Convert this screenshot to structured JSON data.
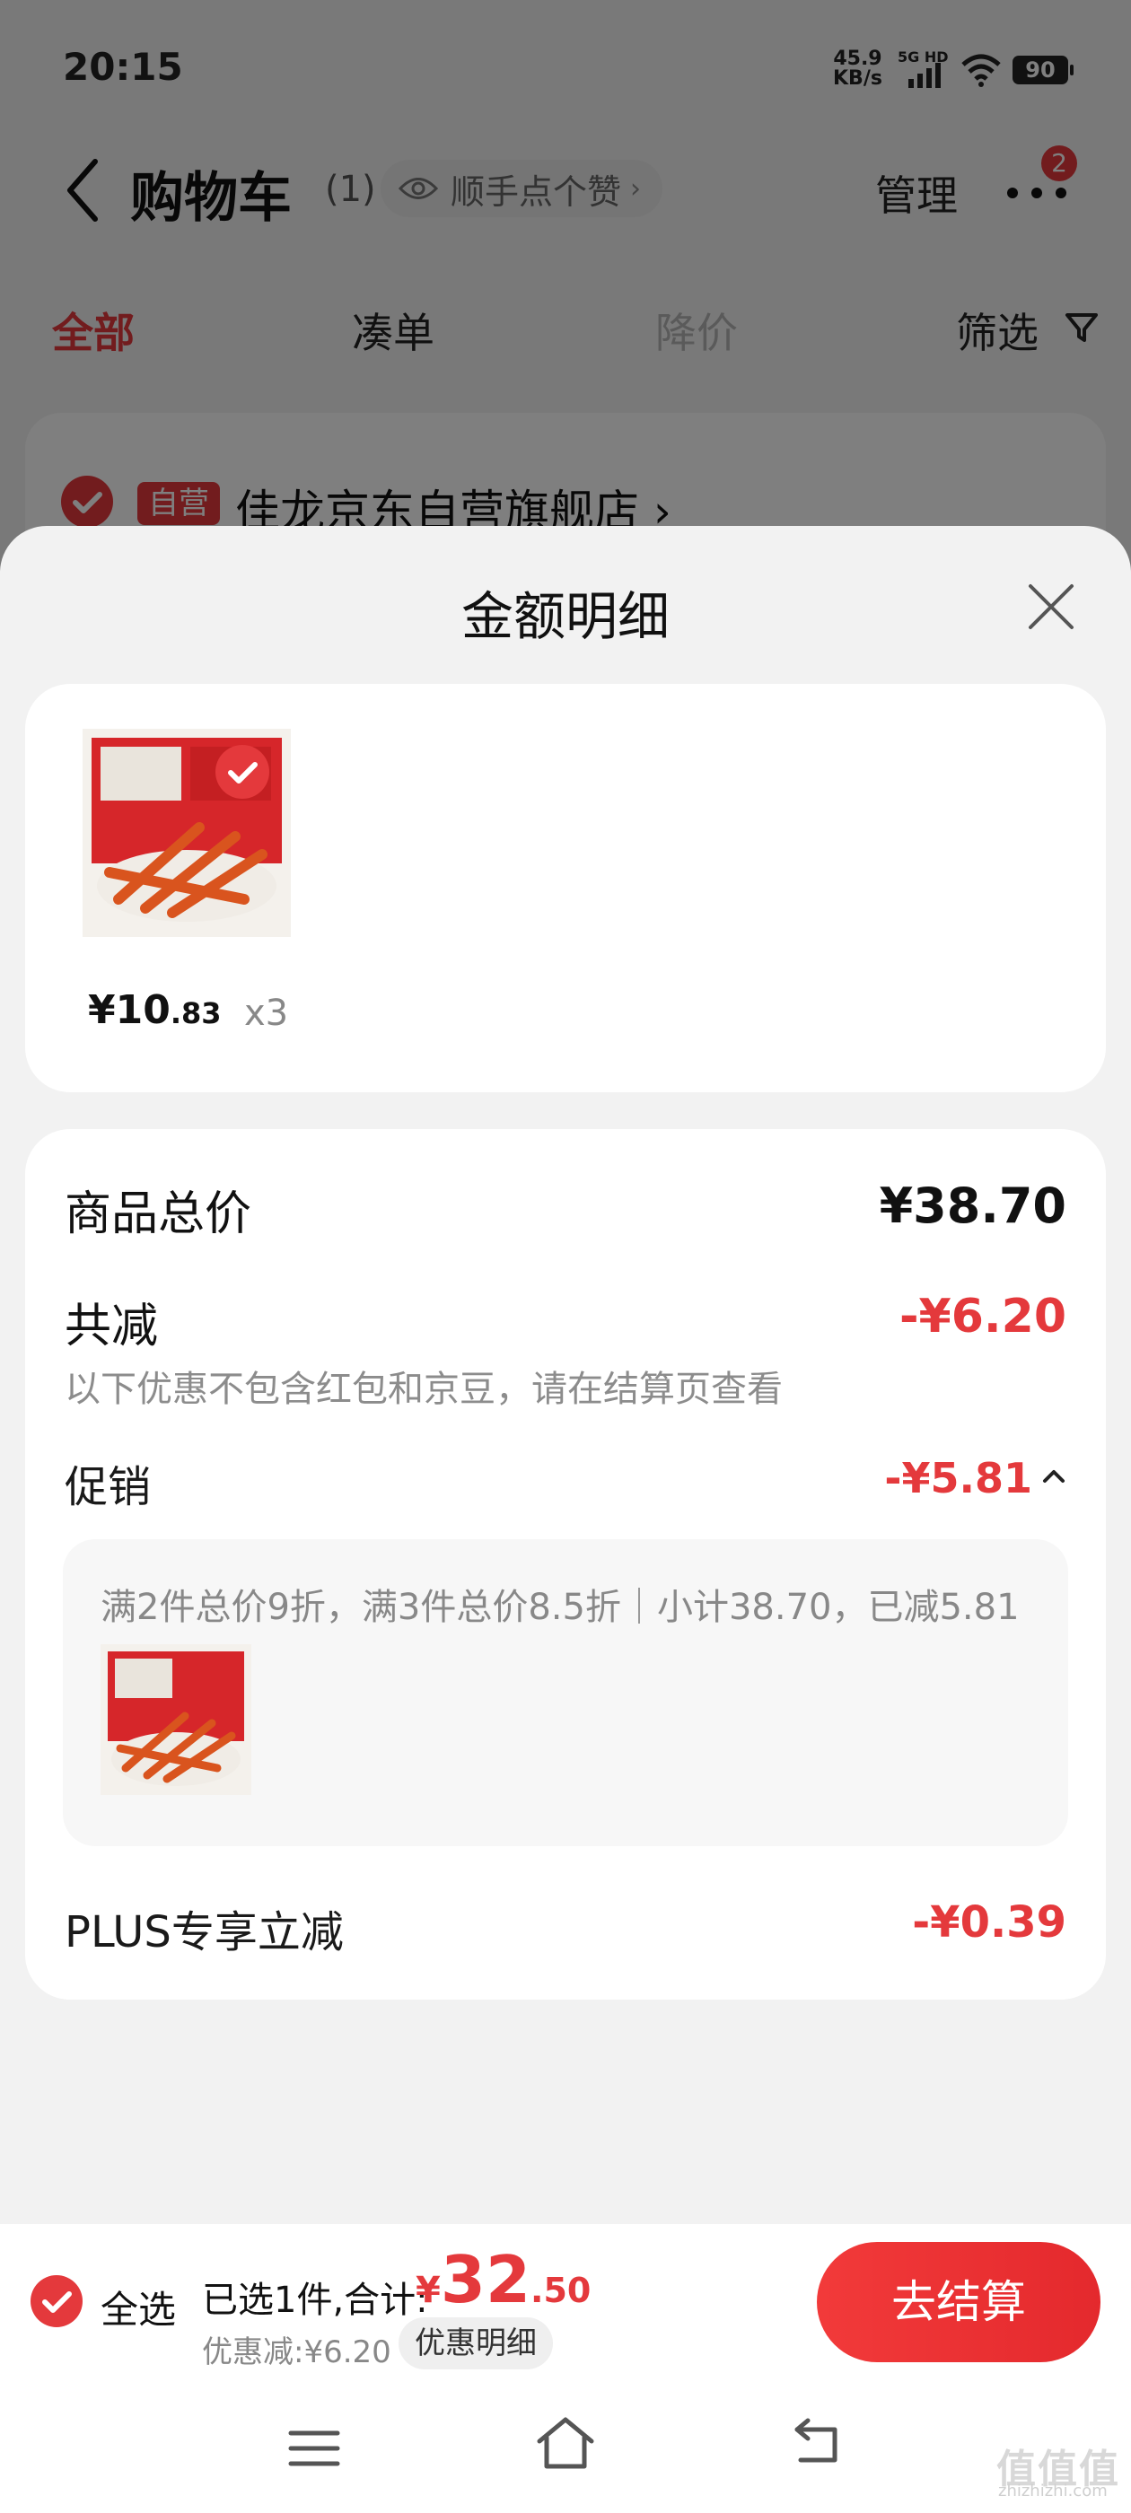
{
  "status_bar": {
    "time": "20:15",
    "net_speed_value": "45.9",
    "net_speed_unit": "KB/s",
    "network": "5G HD",
    "battery": "90"
  },
  "header": {
    "title": "购物车",
    "count": "(1)",
    "like_label": "顺手点个赞",
    "manage_label": "管理",
    "badge": "2"
  },
  "tabs": [
    "全部",
    "凑单",
    "降价",
    "筛选"
  ],
  "store": {
    "tag": "自营",
    "name": "佳龙京东自营旗舰店"
  },
  "sheet": {
    "title": "金额明细",
    "product": {
      "price_int": "¥10",
      "price_dec": ".83",
      "qty": "x3"
    },
    "total_label": "商品总价",
    "total_value": "¥38.70",
    "reduce_label": "共减",
    "reduce_value": "-¥6.20",
    "note": "以下优惠不包含红包和京豆，请在结算页查看",
    "promo_label": "促销",
    "promo_value": "-¥5.81",
    "promo_desc": "满2件总价9折，满3件总价8.5折｜小计38.70，已减5.81",
    "plus_label": "PLUS专享立减",
    "plus_value": "-¥0.39"
  },
  "bottom": {
    "select_all": "全选",
    "selected_text": "已选1件,合计:",
    "yen": "¥",
    "price_int": "32",
    "price_dec": ".50",
    "discount": "优惠减:¥6.20",
    "detail_button": "优惠明细",
    "checkout": "去结算"
  },
  "watermark": {
    "main": "值值值",
    "sub": "zhizhizhi.com"
  },
  "colors": {
    "accent": "#e4393c",
    "muted": "#888888"
  }
}
